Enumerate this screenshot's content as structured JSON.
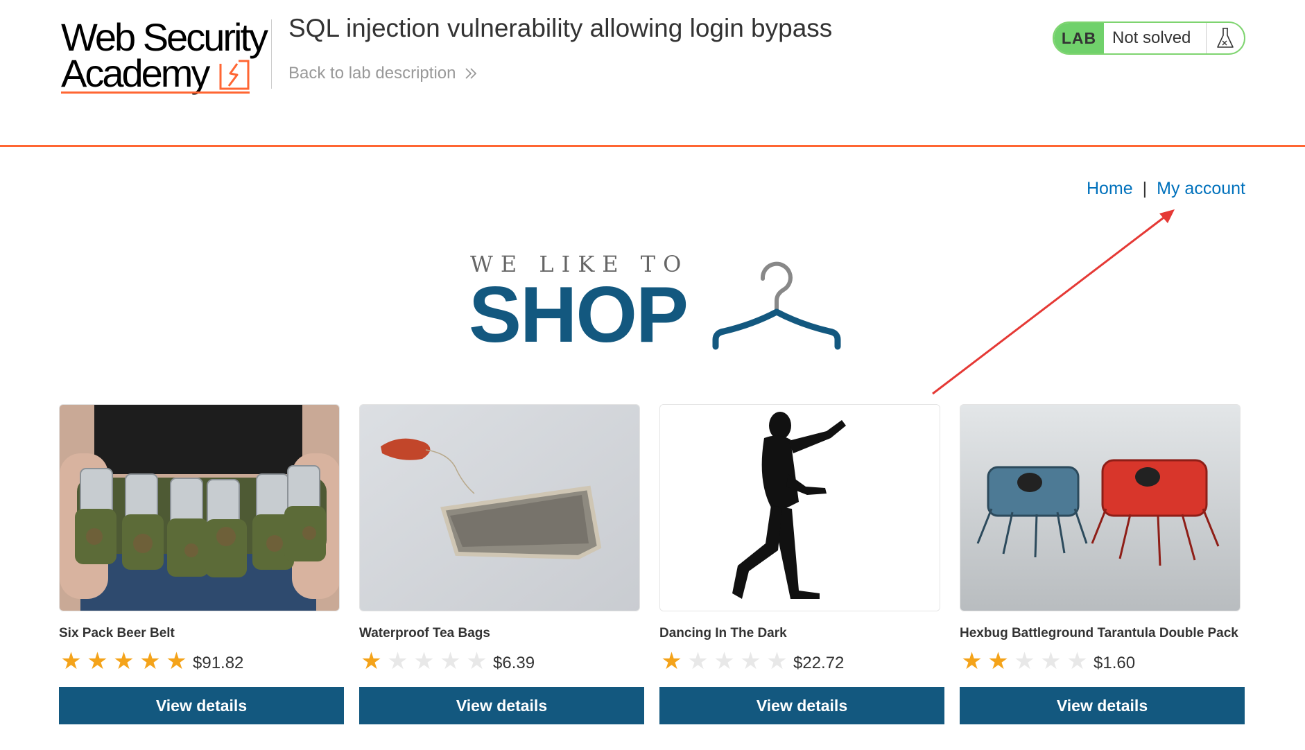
{
  "lab_header": {
    "logo": {
      "line1": "Web Security",
      "line2": "Academy"
    },
    "title": "SQL injection vulnerability allowing login bypass",
    "back_link": "Back to lab description",
    "status": {
      "badge": "LAB",
      "state": "Not solved",
      "icon": "flask-icon"
    },
    "colors": {
      "accent": "#ff6633",
      "status_green": "#70d16b"
    }
  },
  "nav": {
    "home": "Home",
    "separator": "|",
    "account": "My account"
  },
  "hero": {
    "tagline": "WE LIKE TO",
    "headline": "SHOP",
    "icon": "hanger-icon",
    "color": "#13587f"
  },
  "products": [
    {
      "name": "Six Pack Beer Belt",
      "rating": 5,
      "price": "$91.82",
      "button": "View details",
      "image": "beer-belt-image"
    },
    {
      "name": "Waterproof Tea Bags",
      "rating": 1,
      "price": "$6.39",
      "button": "View details",
      "image": "tea-bag-image"
    },
    {
      "name": "Dancing In The Dark",
      "rating": 1,
      "price": "$22.72",
      "button": "View details",
      "image": "dancer-silhouette-image"
    },
    {
      "name": "Hexbug Battleground Tarantula Double Pack",
      "rating": 2,
      "price": "$1.60",
      "button": "View details",
      "image": "hexbug-robots-image"
    }
  ],
  "rating_max": 5,
  "annotation": {
    "type": "arrow",
    "color": "#e53935",
    "points_to": "My account"
  }
}
